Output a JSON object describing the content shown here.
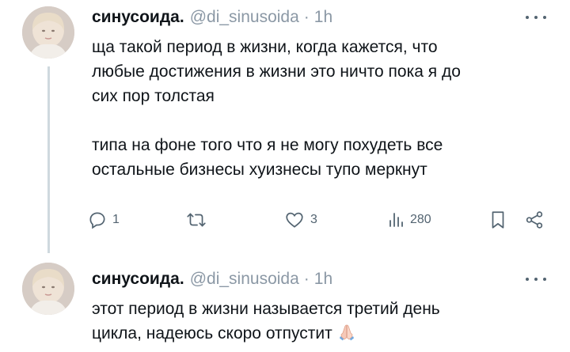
{
  "tweets": [
    {
      "author_name": "синусоида.",
      "handle": "@di_sinusoida",
      "separator": "·",
      "time": "1h",
      "text_lines_1": [
        "ща такой период в жизни, когда кажется, что",
        "любые достижения в жизни это ничто пока я до",
        "сих пор толстая"
      ],
      "text_lines_2": [
        "типа на фоне того что я не могу похудеть все",
        "остальные бизнесы хуизнесы тупо меркнут"
      ],
      "actions": {
        "replies": "1",
        "retweets": "",
        "likes": "3",
        "views": "280"
      }
    },
    {
      "author_name": "синусоида.",
      "handle": "@di_sinusoida",
      "separator": "·",
      "time": "1h",
      "text_lines_1": [
        "этот период в жизни называется третий день",
        "цикла, надеюсь скоро отпустит"
      ],
      "emoji_icon": "praying-hands-icon"
    }
  ],
  "icons": {
    "more": "more-icon",
    "reply": "reply-icon",
    "retweet": "retweet-icon",
    "like": "heart-icon",
    "views": "views-icon",
    "bookmark": "bookmark-icon",
    "share": "share-icon"
  },
  "colors": {
    "text": "#0f1419",
    "secondary": "#536471",
    "thread_line": "#cfd9de"
  }
}
